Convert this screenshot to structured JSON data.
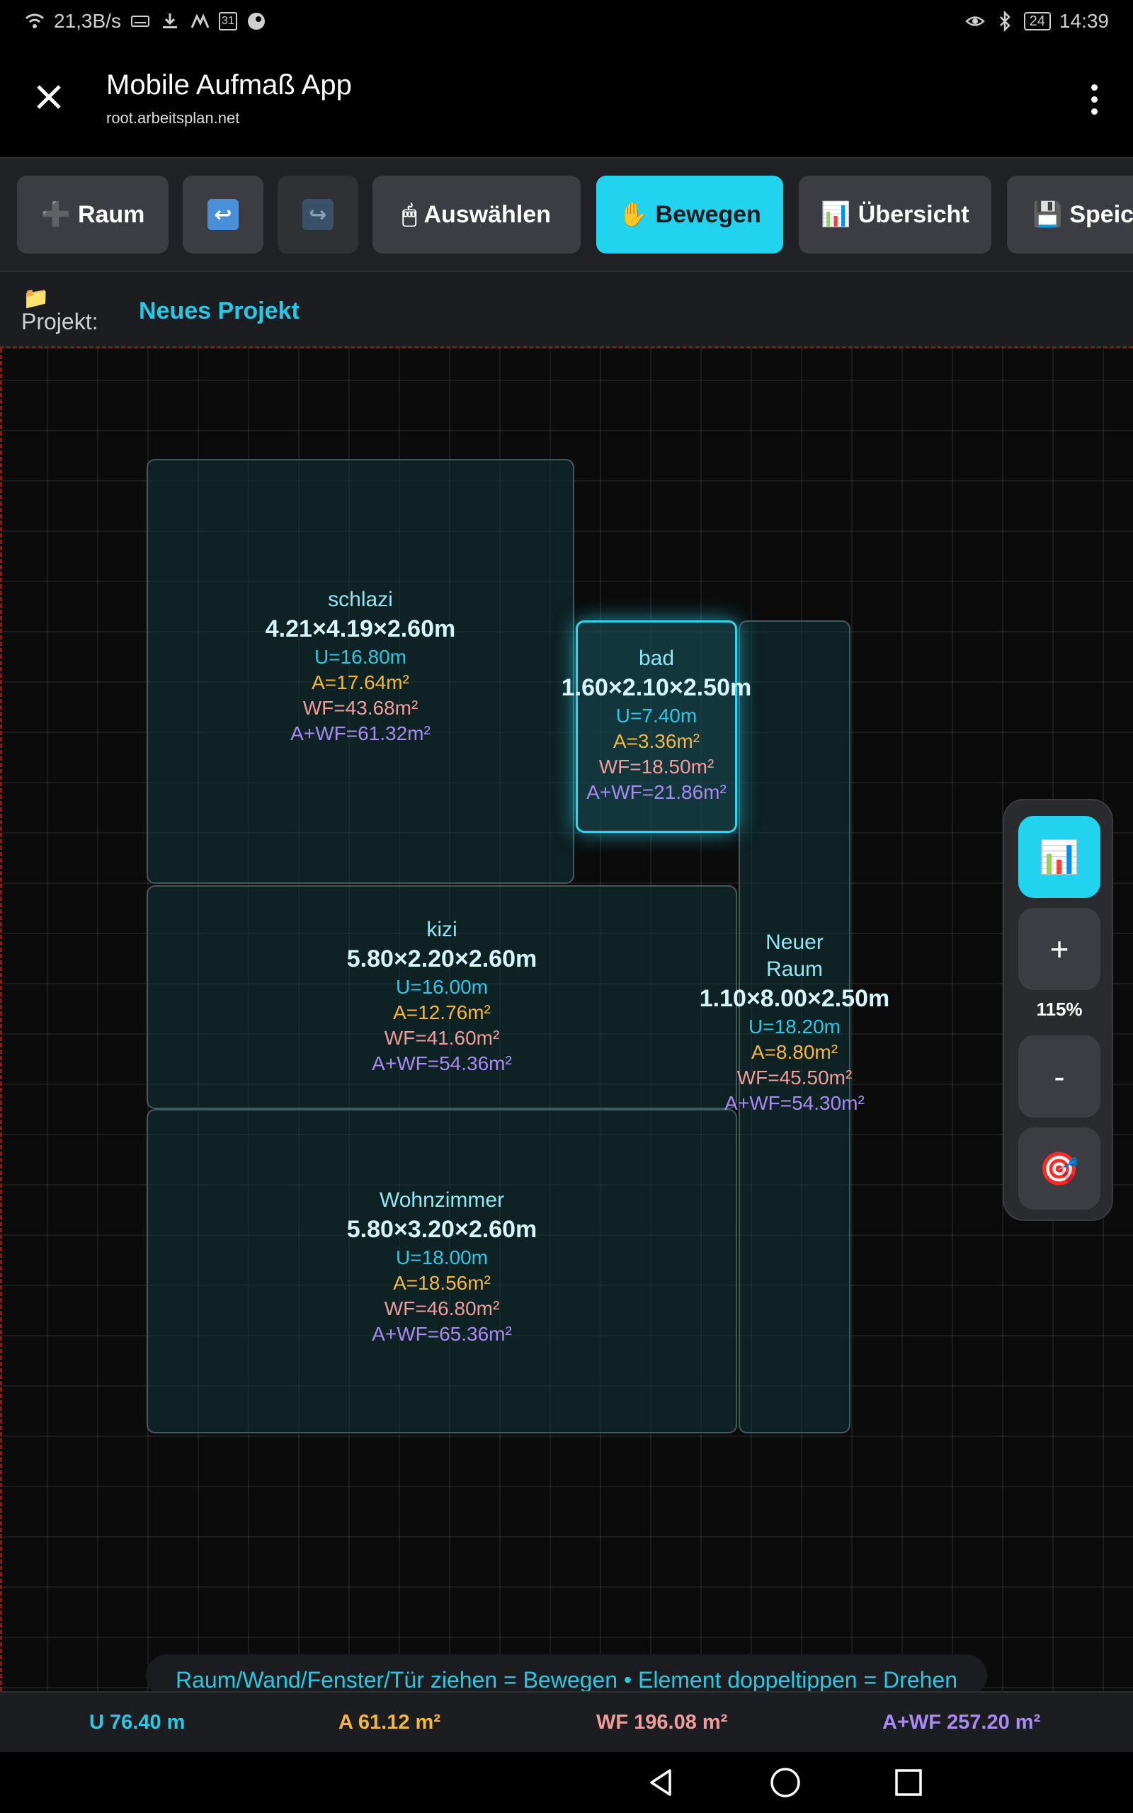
{
  "status_bar": {
    "network_speed": "21,3B/s",
    "battery": "24",
    "time": "14:39",
    "calendar_day": "31"
  },
  "header": {
    "title": "Mobile Aufmaß App",
    "url": "root.arbeitsplan.net"
  },
  "toolbar": {
    "add_room": "Raum",
    "select": "Auswählen",
    "move": "Bewegen",
    "overview": "Übersicht",
    "save": "Speich",
    "active_tool": "move",
    "icons": {
      "add_room": "➕",
      "undo": "↩",
      "redo": "↪",
      "select": "🖱",
      "move": "✋",
      "overview": "📊",
      "save": "💾"
    }
  },
  "project": {
    "folder_icon": "📁",
    "label": "Projekt:",
    "name": "Neues Projekt"
  },
  "rooms": {
    "schlazi": {
      "name": "schlazi",
      "dims": "4.21×4.19×2.60m",
      "u": "U=16.80m",
      "a": "A=17.64m²",
      "wf": "WF=43.68m²",
      "awf": "A+WF=61.32m²"
    },
    "bad": {
      "name": "bad",
      "dims": "1.60×2.10×2.50m",
      "u": "U=7.40m",
      "a": "A=3.36m²",
      "wf": "WF=18.50m²",
      "awf": "A+WF=21.86m²",
      "selected": true
    },
    "kizi": {
      "name": "kizi",
      "dims": "5.80×2.20×2.60m",
      "u": "U=16.00m",
      "a": "A=12.76m²",
      "wf": "WF=41.60m²",
      "awf": "A+WF=54.36m²"
    },
    "wohnzimmer": {
      "name": "Wohnzimmer",
      "dims": "5.80×3.20×2.60m",
      "u": "U=18.00m",
      "a": "A=18.56m²",
      "wf": "WF=46.80m²",
      "awf": "A+WF=65.36m²"
    },
    "neuer_raum": {
      "name_line1": "Neuer",
      "name_line2": "Raum",
      "dims": "1.10×8.00×2.50m",
      "u": "U=18.20m",
      "a": "A=8.80m²",
      "wf": "WF=45.50m²",
      "awf": "A+WF=54.30m²"
    }
  },
  "zoom": {
    "stats_icon": "📊",
    "plus": "+",
    "level": "115%",
    "minus": "-",
    "center_icon": "🎯"
  },
  "hint": "Raum/Wand/Fenster/Tür ziehen = Bewegen • Element doppeltippen = Drehen",
  "summary": {
    "u": "U 76.40 m",
    "a": "A 61.12 m²",
    "wf": "WF 196.08 m²",
    "awf": "A+WF 257.20 m²"
  },
  "colors": {
    "accent": "#21d3ef",
    "u": "#28c8e8",
    "a": "#f5b73a",
    "wf": "#f29b9b",
    "awf": "#a98af5"
  }
}
